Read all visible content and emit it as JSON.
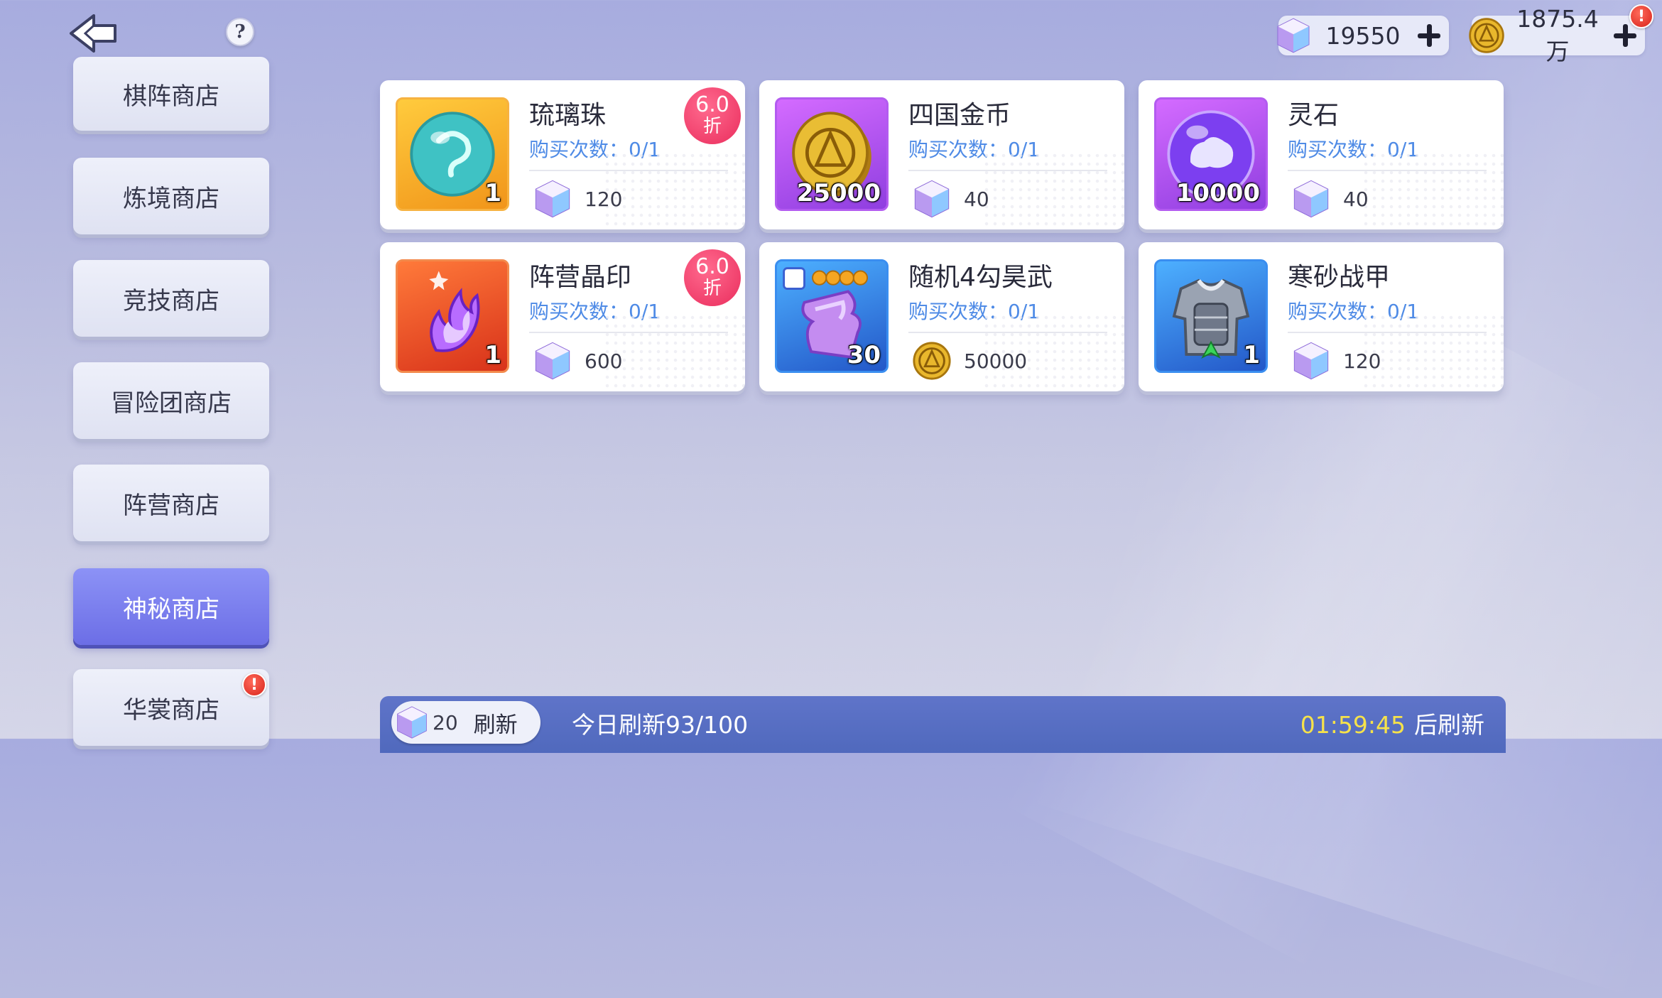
{
  "header": {
    "back_icon": "back-arrow-icon",
    "help_label": "?",
    "gems": {
      "amount": "19550",
      "icon": "crystal-cube-icon"
    },
    "gold": {
      "amount": "1875.4万",
      "icon": "gold-coin-icon",
      "alert": "!"
    }
  },
  "sidebar": {
    "items": [
      {
        "label": "棋阵商店",
        "active": false
      },
      {
        "label": "炼境商店",
        "active": false
      },
      {
        "label": "竞技商店",
        "active": false
      },
      {
        "label": "冒险团商店",
        "active": false
      },
      {
        "label": "阵营商店",
        "active": false
      },
      {
        "label": "神秘商店",
        "active": true
      },
      {
        "label": "华裳商店",
        "active": false,
        "alert": "!"
      }
    ]
  },
  "shop": {
    "limit_prefix": "购买次数：",
    "items": [
      {
        "name": "琉璃珠",
        "qty": "1",
        "limit": "0/1",
        "price": "120",
        "currency": "crystal-cube-icon",
        "discount": "6.0",
        "discount_unit": "折",
        "icon": "glass-bead-icon",
        "frame": "orange"
      },
      {
        "name": "四国金币",
        "qty": "25000",
        "limit": "0/1",
        "price": "40",
        "currency": "crystal-cube-icon",
        "icon": "gold-coin-icon",
        "frame": "purple"
      },
      {
        "name": "灵石",
        "qty": "10000",
        "limit": "0/1",
        "price": "40",
        "currency": "crystal-cube-icon",
        "icon": "spirit-stone-icon",
        "frame": "purple"
      },
      {
        "name": "阵营晶印",
        "qty": "1",
        "limit": "0/1",
        "price": "600",
        "currency": "crystal-cube-icon",
        "discount": "6.0",
        "discount_unit": "折",
        "icon": "faction-seal-icon",
        "frame": "red"
      },
      {
        "name": "随机4勾昊武",
        "qty": "30",
        "limit": "0/1",
        "price": "50000",
        "currency": "gold-coin-icon",
        "icon": "weapon-fragment-icon",
        "frame": "blue"
      },
      {
        "name": "寒砂战甲",
        "qty": "1",
        "limit": "0/1",
        "price": "120",
        "currency": "crystal-cube-icon",
        "icon": "armor-icon",
        "frame": "blue"
      }
    ]
  },
  "footer": {
    "refresh_cost": "20",
    "refresh_label": "刷新",
    "today_refresh": "今日刷新93/100",
    "countdown": "01:59:45",
    "countdown_suffix": "后刷新"
  },
  "colors": {
    "active_tab": "#6c6ee6",
    "limit_text": "#4f8be6",
    "discount_badge": "#ea2d5d",
    "bottom_bar": "#5069bd",
    "timer": "#f6e24a"
  }
}
